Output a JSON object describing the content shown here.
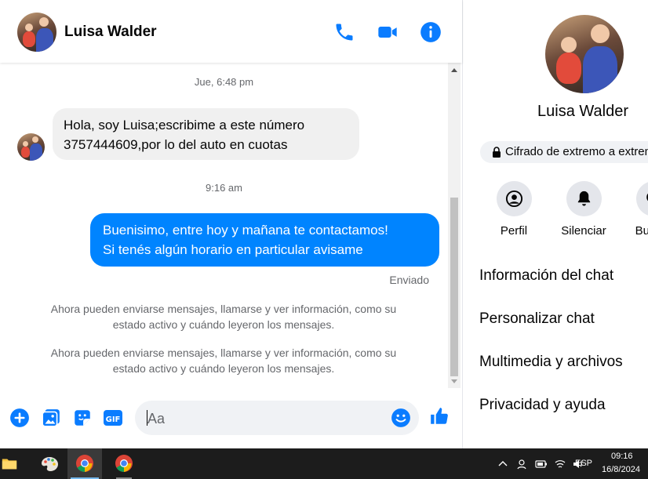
{
  "colors": {
    "accent": "#0084ff",
    "messenger_blue": "#0a7cff",
    "muted": "#65676b"
  },
  "chat_header": {
    "name": "Luisa Walder",
    "icons": [
      "phone-icon",
      "video-camera-icon",
      "info-icon"
    ]
  },
  "messages": {
    "timestamp_1": "Jue, 6:48 pm",
    "incoming": {
      "line1": "Hola, soy Luisa;escribime a este número",
      "line2": "3757444609,por lo del auto en cuotas"
    },
    "timestamp_2": "9:16 am",
    "outgoing": {
      "line1": "Buenisimo, entre hoy y mañana te contactamos!",
      "line2": "Si tenés algún horario en particular avisame"
    },
    "status": "Enviado",
    "system_1": {
      "line1": "Ahora pueden enviarse mensajes, llamarse y ver información, como su",
      "line2": "estado activo y cuándo leyeron los mensajes."
    },
    "system_2": {
      "line1": "Ahora pueden enviarse mensajes, llamarse y ver información, como su",
      "line2": "estado activo y cuándo leyeron los mensajes."
    }
  },
  "composer": {
    "placeholder": "Aa",
    "icons": [
      "plus-icon",
      "gallery-icon",
      "sticker-icon",
      "gif-icon",
      "emoji-icon",
      "thumbs-up-icon"
    ],
    "gif_label": "GIF"
  },
  "info_panel": {
    "name": "Luisa Walder",
    "encryption": "Cifrado de extremo a extremo",
    "actions": [
      {
        "label": "Perfil",
        "icon": "profile-icon"
      },
      {
        "label": "Silenciar",
        "icon": "bell-icon"
      },
      {
        "label": "Buscar",
        "icon": "search-icon"
      }
    ],
    "menu": [
      "Información del chat",
      "Personalizar chat",
      "Multimedia y archivos",
      "Privacidad y ayuda"
    ]
  },
  "taskbar": {
    "apps": [
      "file-explorer-icon",
      "paint-icon",
      "chrome-icon",
      "chrome-icon"
    ],
    "language": "ESP",
    "time": "09:16",
    "date": "16/8/2024"
  }
}
